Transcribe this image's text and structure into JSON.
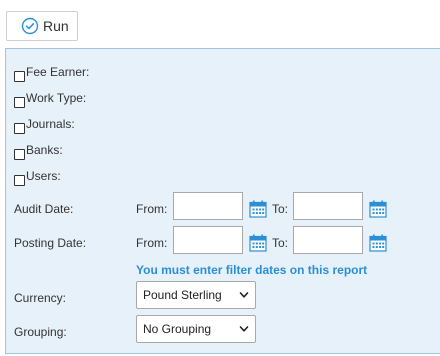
{
  "toolbar": {
    "run_label": "Run"
  },
  "filters": {
    "checkboxes": [
      {
        "label": "Fee Earner:",
        "checked": false
      },
      {
        "label": "Work Type:",
        "checked": false
      },
      {
        "label": "Journals:",
        "checked": false
      },
      {
        "label": "Banks:",
        "checked": false
      },
      {
        "label": "Users:",
        "checked": false
      }
    ],
    "audit_date": {
      "label": "Audit Date:",
      "from_label": "From:",
      "to_label": "To:",
      "from_value": "",
      "to_value": ""
    },
    "posting_date": {
      "label": "Posting Date:",
      "from_label": "From:",
      "to_label": "To:",
      "from_value": "",
      "to_value": ""
    },
    "warning": "You must enter filter dates on this report",
    "currency": {
      "label": "Currency:",
      "selected": "Pound Sterling"
    },
    "grouping": {
      "label": "Grouping:",
      "selected": "No Grouping"
    }
  },
  "colors": {
    "accent": "#2b8fd8",
    "panel_bg": "#e6f1f9",
    "panel_border": "#9ec6e0"
  },
  "icons": {
    "run": "check-circle-icon",
    "calendar": "calendar-icon",
    "dropdown": "chevron-down-icon"
  }
}
